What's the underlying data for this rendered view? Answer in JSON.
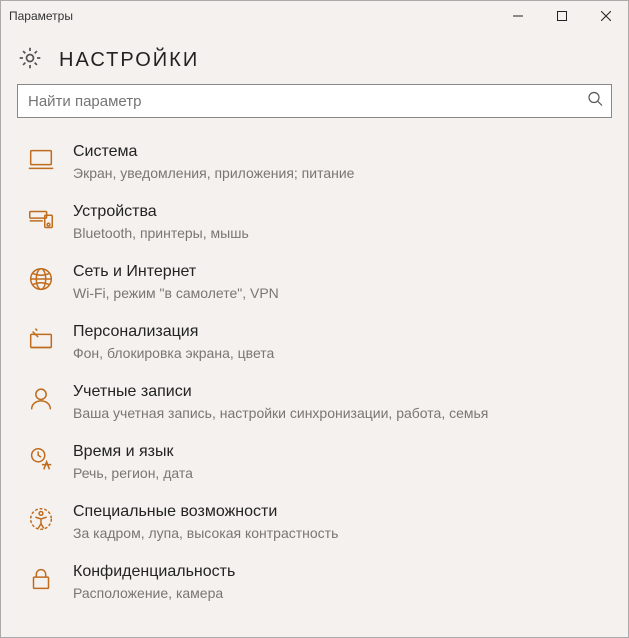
{
  "window": {
    "title": "Параметры"
  },
  "header": {
    "title": "НАСТРОЙКИ"
  },
  "search": {
    "placeholder": "Найти параметр"
  },
  "items": [
    {
      "name": "Система",
      "desc": "Экран, уведомления, приложения; питание"
    },
    {
      "name": "Устройства",
      "desc": "Bluetooth, принтеры, мышь"
    },
    {
      "name": "Сеть и Интернет",
      "desc": "Wi-Fi, режим \"в самолете\", VPN"
    },
    {
      "name": "Персонализация",
      "desc": "Фон, блокировка экрана, цвета"
    },
    {
      "name": "Учетные записи",
      "desc": "Ваша учетная запись, настройки синхронизации, работа, семья"
    },
    {
      "name": "Время и язык",
      "desc": "Речь, регион, дата"
    },
    {
      "name": "Специальные возможности",
      "desc": "За кадром, лупа, высокая контрастность"
    },
    {
      "name": "Конфиденциальность",
      "desc": "Расположение, камера"
    }
  ]
}
